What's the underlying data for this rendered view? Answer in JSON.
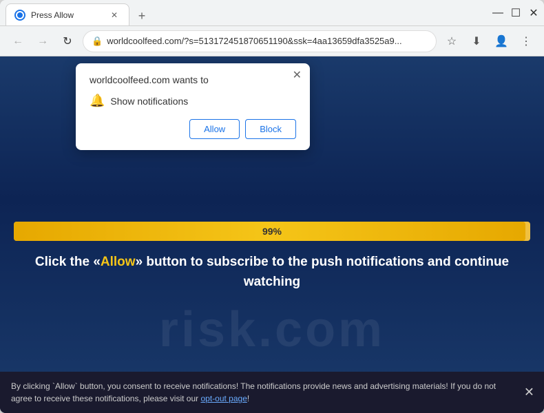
{
  "browser": {
    "tab": {
      "title": "Press Allow",
      "favicon": "globe"
    },
    "new_tab_label": "+",
    "window_controls": {
      "minimize": "—",
      "maximize": "☐",
      "close": "✕"
    },
    "nav": {
      "back": "←",
      "forward": "→",
      "refresh": "↻"
    },
    "url": "worldcoolfeed.com/?s=513172451870651190&ssk=4aa13659dfa3525a9...",
    "star_label": "☆",
    "profile_label": "👤",
    "menu_label": "⋮",
    "download_icon": "⬇"
  },
  "popup": {
    "title": "worldcoolfeed.com wants to",
    "permission_icon": "🔔",
    "permission_text": "Show notifications",
    "close_icon": "✕",
    "allow_button": "Allow",
    "block_button": "Block"
  },
  "page": {
    "progress_percent": "99%",
    "progress_value": 99,
    "main_message_before": "Click the «",
    "main_message_highlight": "Allow",
    "main_message_after": "» button to subscribe to the push notifications and continue watching",
    "watermark": "risk.com"
  },
  "banner": {
    "text_before": "By clicking `Allow` button, you consent to receive notifications! The notifications provide news and advertising materials! If you do not agree to receive these notifications, please visit our ",
    "opt_out_text": "opt-out page",
    "text_after": "!",
    "close_icon": "✕"
  }
}
